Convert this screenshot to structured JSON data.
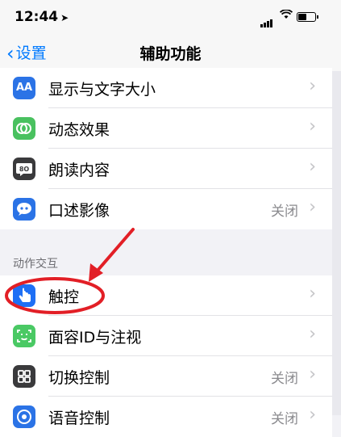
{
  "status": {
    "time": "12:44",
    "location_icon": "location-arrow-icon"
  },
  "nav": {
    "back_label": "设置",
    "title": "辅助功能"
  },
  "top_group": [
    {
      "label": "显示与文字大小",
      "icon": "display-text-size-icon",
      "icon_text": "AA",
      "value": ""
    },
    {
      "label": "动态效果",
      "icon": "motion-icon",
      "icon_text": "",
      "value": ""
    },
    {
      "label": "朗读内容",
      "icon": "spoken-content-icon",
      "icon_text": "8O",
      "value": ""
    },
    {
      "label": "口述影像",
      "icon": "audio-description-icon",
      "icon_text": "",
      "value": "关闭"
    }
  ],
  "section_header": "动作交互",
  "interaction_group": [
    {
      "label": "触控",
      "icon": "touch-hand-icon",
      "value": ""
    },
    {
      "label": "面容ID与注视",
      "icon": "face-id-icon",
      "value": ""
    },
    {
      "label": "切换控制",
      "icon": "switch-control-icon",
      "value": "关闭"
    },
    {
      "label": "语音控制",
      "icon": "voice-control-icon",
      "value": "关闭"
    }
  ],
  "colors": {
    "accent": "#007aff",
    "annotation": "#e21f26"
  }
}
